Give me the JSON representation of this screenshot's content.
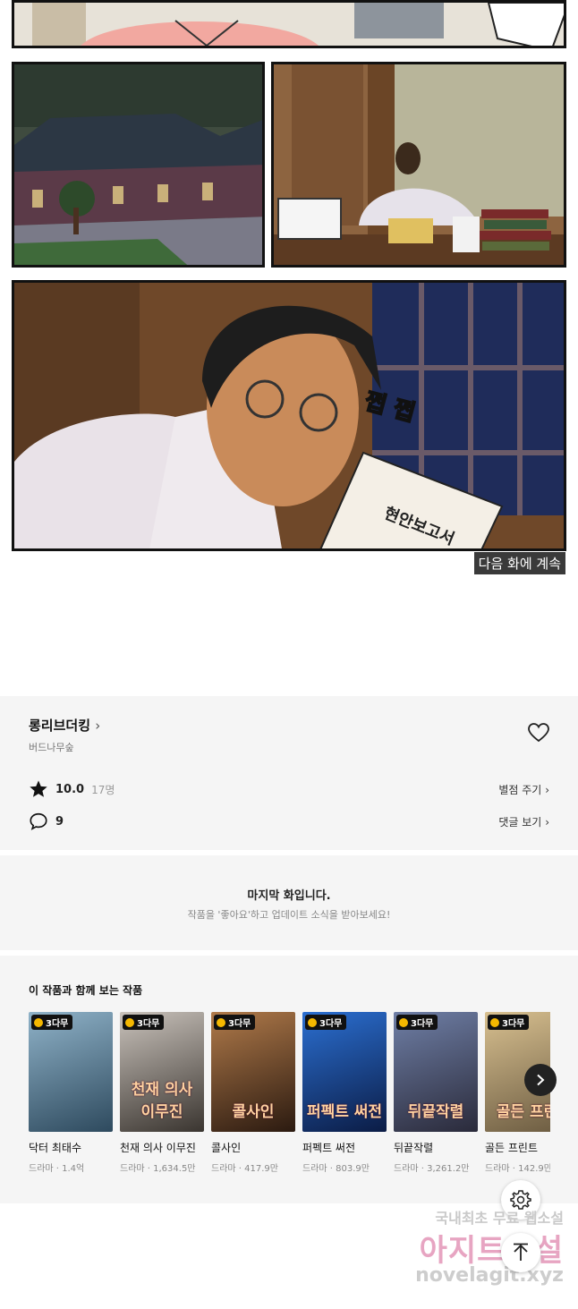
{
  "comic": {
    "continue_label": "다음 화에 계속",
    "sfx_text": "쩝 쩝",
    "document_title": "현안보고서"
  },
  "series": {
    "title": "롱리브더킹",
    "author": "버드나무숲",
    "rating": "10.0",
    "rating_count": "17명",
    "rate_button": "별점 주기",
    "comment_count": "9",
    "comments_button": "댓글 보기"
  },
  "last_episode": {
    "title": "마지막 화입니다.",
    "subtitle": "작품을 '좋아요'하고 업데이트 소식을 받아보세요!"
  },
  "recommend": {
    "heading": "이 작품과 함께 보는 작품",
    "badge": "3다무",
    "items": [
      {
        "title": "닥터 최태수",
        "meta": "드라마 · 1.4억",
        "overlay": "",
        "color_a": "#8fb2c8",
        "color_b": "#2e4a5e"
      },
      {
        "title": "천재 의사 이무진",
        "meta": "드라마 · 1,634.5만",
        "overlay": "천재 의사 이무진",
        "color_a": "#c9c2bb",
        "color_b": "#3a3530"
      },
      {
        "title": "콜사인",
        "meta": "드라마 · 417.9만",
        "overlay": "콜사인",
        "color_a": "#b07a4a",
        "color_b": "#2b1a10"
      },
      {
        "title": "퍼펙트 써전",
        "meta": "드라마 · 803.9만",
        "overlay": "퍼펙트 써전",
        "color_a": "#2b6fd1",
        "color_b": "#0b1c45"
      },
      {
        "title": "뒤끝작렬",
        "meta": "드라마 · 3,261.2만",
        "overlay": "뒤끝작렬",
        "color_a": "#6f7fa6",
        "color_b": "#2a2a3a"
      },
      {
        "title": "골든 프린트",
        "meta": "드라마 · 142.9만",
        "overlay": "골든 프린",
        "color_a": "#d8c090",
        "color_b": "#6a5a40"
      }
    ]
  },
  "watermark": {
    "line1": "국내최초 무료 웹소설",
    "line2": "아지트소설",
    "line3": "novelagit.xyz"
  }
}
